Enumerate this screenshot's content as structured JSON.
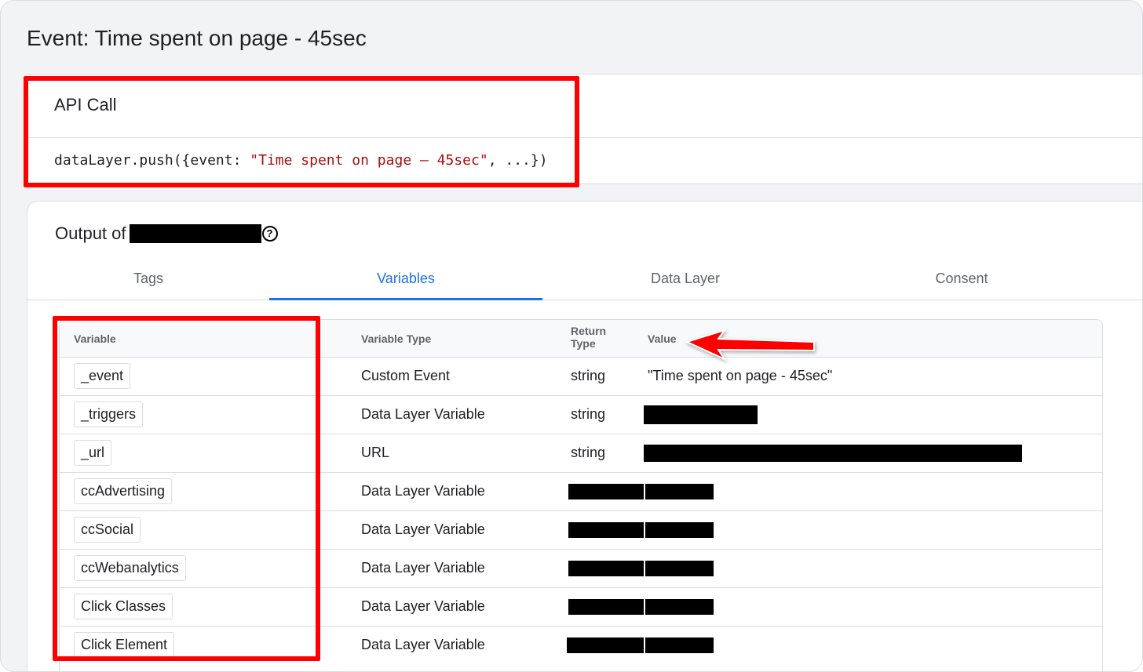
{
  "event": {
    "title": "Event: Time spent on page - 45sec"
  },
  "api_call": {
    "heading": "API Call",
    "code_prefix": "dataLayer.push({event: ",
    "code_string": "\"Time spent on page – 45sec\"",
    "code_suffix": ", ...})"
  },
  "output": {
    "title": "Output of",
    "help_icon": "question-circle-icon"
  },
  "tabs": [
    {
      "label": "Tags",
      "active": false
    },
    {
      "label": "Variables",
      "active": true
    },
    {
      "label": "Data Layer",
      "active": false
    },
    {
      "label": "Consent",
      "active": false
    }
  ],
  "table": {
    "headers": {
      "variable": "Variable",
      "type": "Variable Type",
      "return_type": "Return Type",
      "value": "Value"
    },
    "rows": [
      {
        "name": "_event",
        "type": "Custom Event",
        "return_type": "string",
        "value": "\"Time spent on page - 45sec\""
      },
      {
        "name": "_triggers",
        "type": "Data Layer Variable",
        "return_type": "string",
        "value": ""
      },
      {
        "name": "_url",
        "type": "URL",
        "return_type": "string",
        "value": ""
      },
      {
        "name": "ccAdvertising",
        "type": "Data Layer Variable",
        "return_type": "",
        "value": ""
      },
      {
        "name": "ccSocial",
        "type": "Data Layer Variable",
        "return_type": "",
        "value": ""
      },
      {
        "name": "ccWebanalytics",
        "type": "Data Layer Variable",
        "return_type": "",
        "value": ""
      },
      {
        "name": "Click Classes",
        "type": "Data Layer Variable",
        "return_type": "",
        "value": ""
      },
      {
        "name": "Click Element",
        "type": "Data Layer Variable",
        "return_type": "",
        "value": ""
      }
    ]
  },
  "colors": {
    "active_tab": "#1a73e8",
    "annotation": "#ff0000",
    "code_string": "#a50e0e"
  }
}
